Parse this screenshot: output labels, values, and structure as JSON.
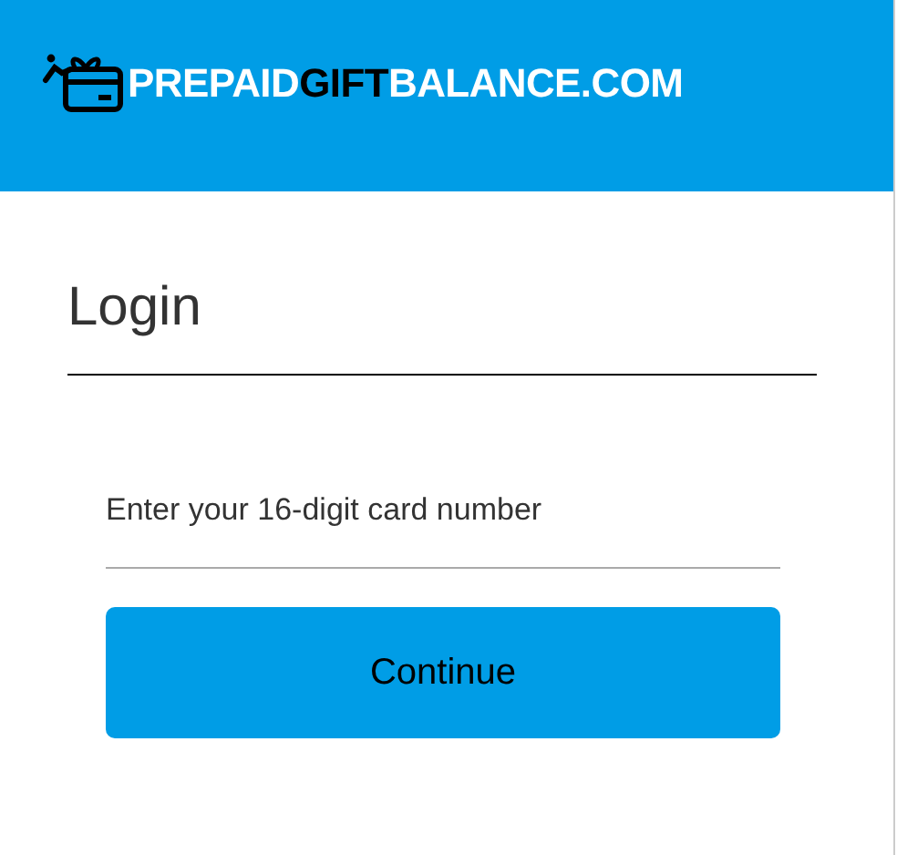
{
  "header": {
    "logo_parts": [
      {
        "text": "PREPAID",
        "color": "#ffffff"
      },
      {
        "text": "GIFT",
        "color": "#000000"
      },
      {
        "text": "BALANCE.COM",
        "color": "#ffffff"
      }
    ]
  },
  "title": "Login",
  "card_field": {
    "placeholder": "Enter your 16-digit card number"
  },
  "button": "Continue"
}
